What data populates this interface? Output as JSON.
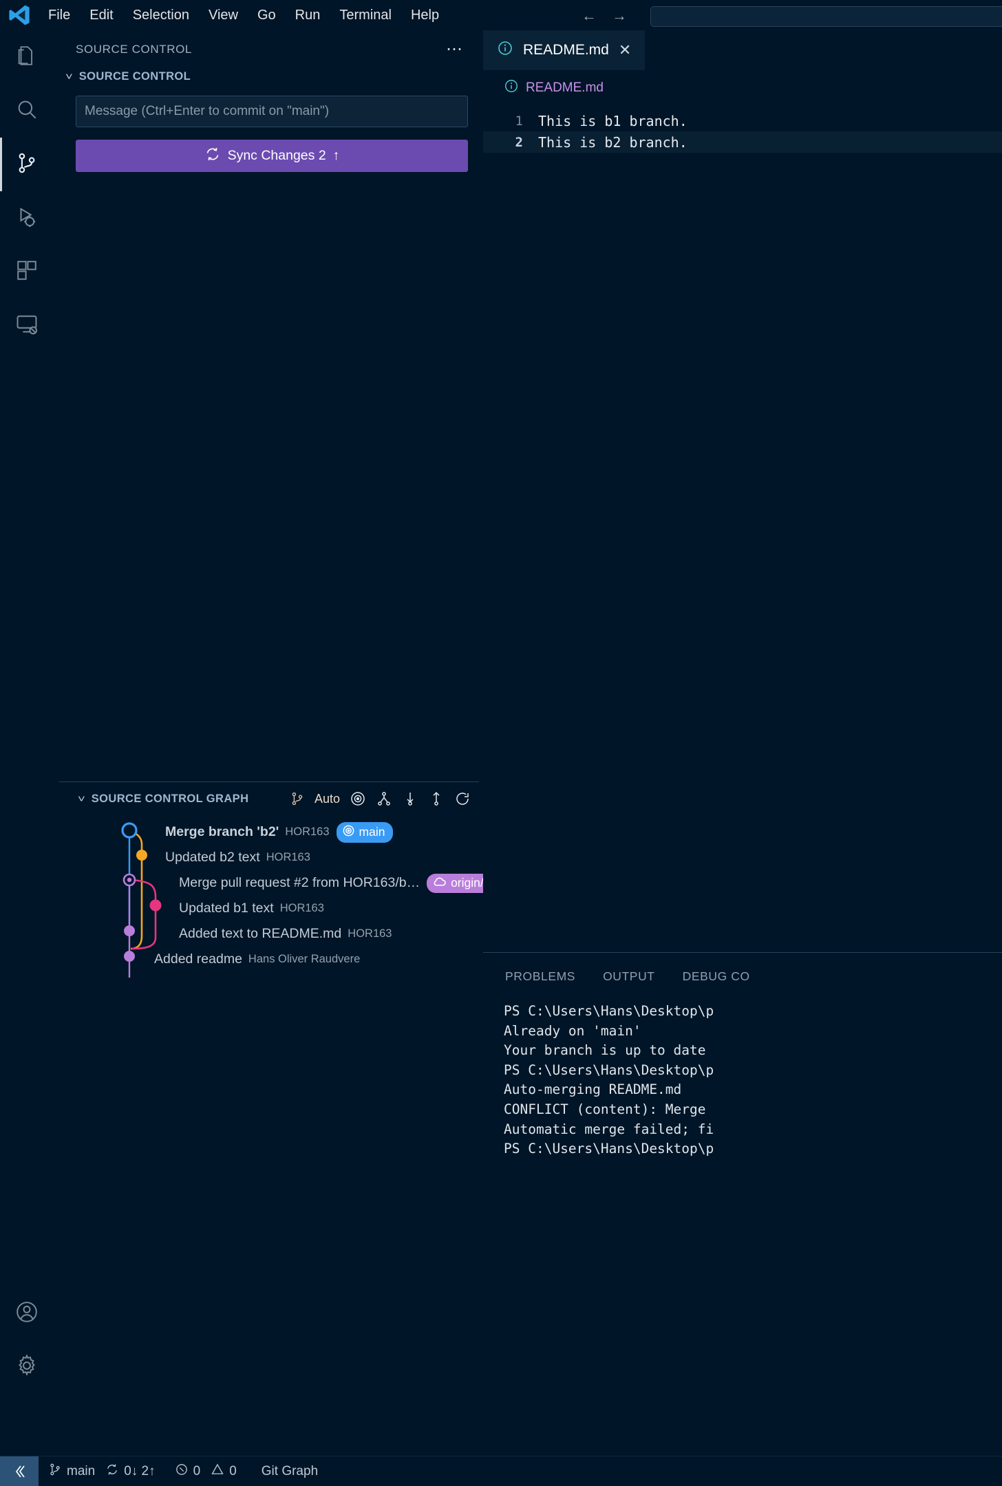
{
  "titlebar": {
    "logo_icon": "vscode-logo",
    "menu": [
      "File",
      "Edit",
      "Selection",
      "View",
      "Go",
      "Run",
      "Terminal",
      "Help"
    ],
    "nav_back_icon": "arrow-left-icon",
    "nav_forward_icon": "arrow-right-icon",
    "search_placeholder": ""
  },
  "activitybar": {
    "items": [
      {
        "name": "explorer",
        "icon": "files-icon",
        "active": false
      },
      {
        "name": "search",
        "icon": "search-icon",
        "active": false
      },
      {
        "name": "source-control",
        "icon": "source-control-icon",
        "active": true
      },
      {
        "name": "run-and-debug",
        "icon": "run-debug-icon",
        "active": false
      },
      {
        "name": "extensions",
        "icon": "extensions-icon",
        "active": false
      },
      {
        "name": "remote-explorer",
        "icon": "remote-explorer-icon",
        "active": false
      }
    ],
    "bottom": [
      {
        "name": "accounts",
        "icon": "account-icon"
      },
      {
        "name": "manage",
        "icon": "gear-icon"
      }
    ]
  },
  "sidebar": {
    "view_title": "SOURCE CONTROL",
    "more_actions_icon": "ellipsis-icon",
    "section": {
      "chevron_icon": "chevron-down-icon",
      "label": "SOURCE CONTROL"
    },
    "commit_input": {
      "placeholder": "Message (Ctrl+Enter to commit on \"main\")",
      "value": ""
    },
    "sync_button": {
      "icon": "sync-icon",
      "label": "Sync Changes 2",
      "arrow": "↑"
    }
  },
  "graph": {
    "chevron_icon": "chevron-down-icon",
    "label": "SOURCE CONTROL GRAPH",
    "tools": [
      {
        "name": "branch-auto",
        "icon": "git-branch-icon",
        "label": "Auto"
      },
      {
        "name": "fetch",
        "icon": "target-icon",
        "label": ""
      },
      {
        "name": "pull",
        "icon": "git-pull-icon",
        "label": ""
      },
      {
        "name": "fetch-all",
        "icon": "git-fetch-icon",
        "label": ""
      },
      {
        "name": "push",
        "icon": "git-push-icon",
        "label": ""
      },
      {
        "name": "refresh",
        "icon": "refresh-icon",
        "label": ""
      }
    ],
    "commits": [
      {
        "message": "Merge branch 'b2'",
        "author": "HOR163",
        "bold": true,
        "badges": [
          {
            "label": "main",
            "type": "main",
            "icon": "target-icon"
          }
        ]
      },
      {
        "message": "Updated b2 text",
        "author": "HOR163",
        "bold": false,
        "badges": []
      },
      {
        "message": "Merge pull request #2 from HOR163/b…",
        "author": "",
        "bold": false,
        "badges": [
          {
            "label": "origin/main",
            "type": "origin",
            "icon": "cloud-icon"
          }
        ]
      },
      {
        "message": "Updated b1 text",
        "author": "HOR163",
        "bold": false,
        "badges": []
      },
      {
        "message": "Added text to README.md",
        "author": "HOR163",
        "bold": false,
        "badges": []
      },
      {
        "message": "Added readme",
        "author": "Hans Oliver Raudvere",
        "bold": false,
        "badges": []
      }
    ],
    "colors": {
      "blue": "#3a9bf5",
      "orange": "#f5a623",
      "purple": "#b97edb",
      "pink": "#e8357f"
    }
  },
  "editor": {
    "tab": {
      "icon": "info-icon",
      "label": "README.md",
      "close_icon": "close-icon"
    },
    "breadcrumb": {
      "icon": "info-icon",
      "label": "README.md"
    },
    "lines": [
      {
        "number": "1",
        "text": "This is b1 branch.",
        "current": false
      },
      {
        "number": "2",
        "text": "This is b2 branch.",
        "current": true
      }
    ]
  },
  "panel": {
    "tabs": [
      "PROBLEMS",
      "OUTPUT",
      "DEBUG CO"
    ],
    "terminal_lines": [
      "PS C:\\Users\\Hans\\Desktop\\p",
      "Already on 'main'",
      "Your branch is up to date",
      "PS C:\\Users\\Hans\\Desktop\\p",
      "Auto-merging README.md",
      "CONFLICT (content): Merge",
      "Automatic merge failed; fi",
      "PS C:\\Users\\Hans\\Desktop\\p"
    ]
  },
  "statusbar": {
    "remote_icon": "remote-window-icon",
    "branch_icon": "git-branch-icon",
    "branch": "main",
    "sync_icon": "sync-icon",
    "sync_counts": "0↓ 2↑",
    "errors_icon": "error-icon",
    "errors": "0",
    "warnings_icon": "warning-icon",
    "warnings": "0",
    "git_graph": "Git Graph"
  }
}
